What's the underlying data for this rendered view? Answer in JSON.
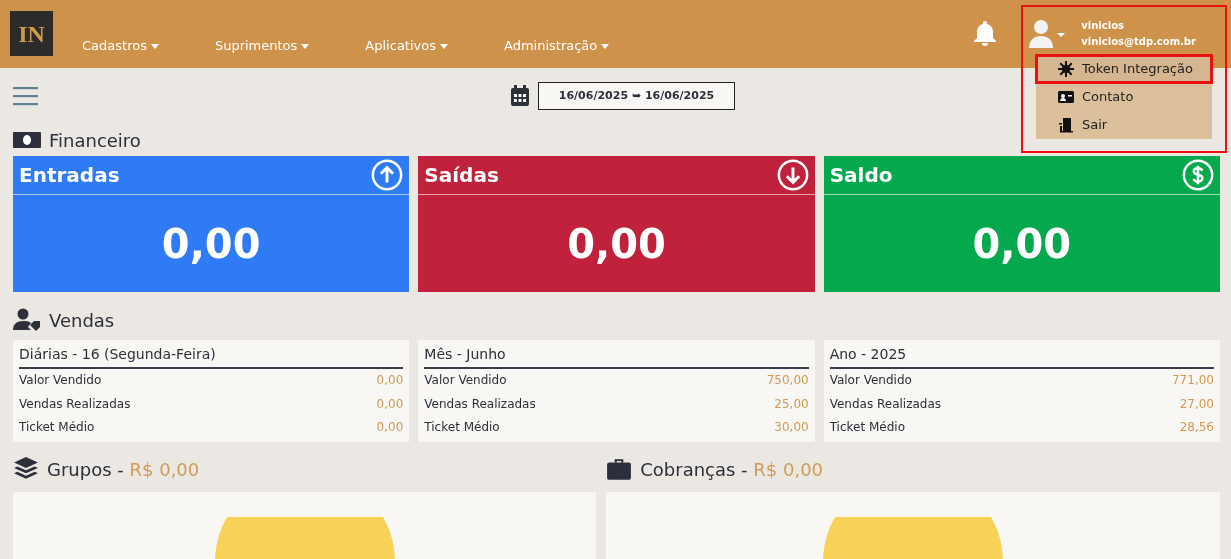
{
  "navbar": {
    "logo": "IN",
    "menus": [
      {
        "label": "Cadastros"
      },
      {
        "label": "Suprimentos"
      },
      {
        "label": "Aplicativos"
      },
      {
        "label": "Administração"
      }
    ],
    "user": {
      "name": "vinicios",
      "email": "vinicios@tdp.com.br",
      "highlighted": true,
      "menu": [
        {
          "label": "Token Integração",
          "kind": "token",
          "highlighted": true
        },
        {
          "label": "Contato",
          "kind": "contact",
          "highlighted": false
        },
        {
          "label": "Sair",
          "kind": "exit",
          "highlighted": false
        }
      ]
    }
  },
  "date_range": "16/06/2025 ➥ 16/06/2025",
  "financeiro": {
    "title": "Financeiro",
    "cards": [
      {
        "title": "Entradas",
        "kind": "in",
        "value": "0,00",
        "color": "#2f7bf5"
      },
      {
        "title": "Saídas",
        "kind": "out",
        "value": "0,00",
        "color": "#c0223b"
      },
      {
        "title": "Saldo",
        "kind": "balance",
        "value": "0,00",
        "color": "#05a84c"
      }
    ]
  },
  "vendas": {
    "title": "Vendas",
    "panels": [
      {
        "title": "Diárias - 16 (Segunda-Feira)",
        "rows": [
          {
            "label": "Valor Vendido",
            "value": "0,00"
          },
          {
            "label": "Vendas Realizadas",
            "value": "0,00"
          },
          {
            "label": "Ticket Médio",
            "value": "0,00"
          }
        ]
      },
      {
        "title": "Mês - Junho",
        "rows": [
          {
            "label": "Valor Vendido",
            "value": "750,00"
          },
          {
            "label": "Vendas Realizadas",
            "value": "25,00"
          },
          {
            "label": "Ticket Médio",
            "value": "30,00"
          }
        ]
      },
      {
        "title": "Ano - 2025",
        "rows": [
          {
            "label": "Valor Vendido",
            "value": "771,00"
          },
          {
            "label": "Vendas Realizadas",
            "value": "27,00"
          },
          {
            "label": "Ticket Médio",
            "value": "28,56"
          }
        ]
      }
    ]
  },
  "charts": [
    {
      "title": "Grupos",
      "separator": "-",
      "amount": "R$ 0,00",
      "kind": "layers"
    },
    {
      "title": "Cobranças",
      "separator": "-",
      "amount": "R$ 0,00",
      "kind": "briefcase"
    }
  ]
}
